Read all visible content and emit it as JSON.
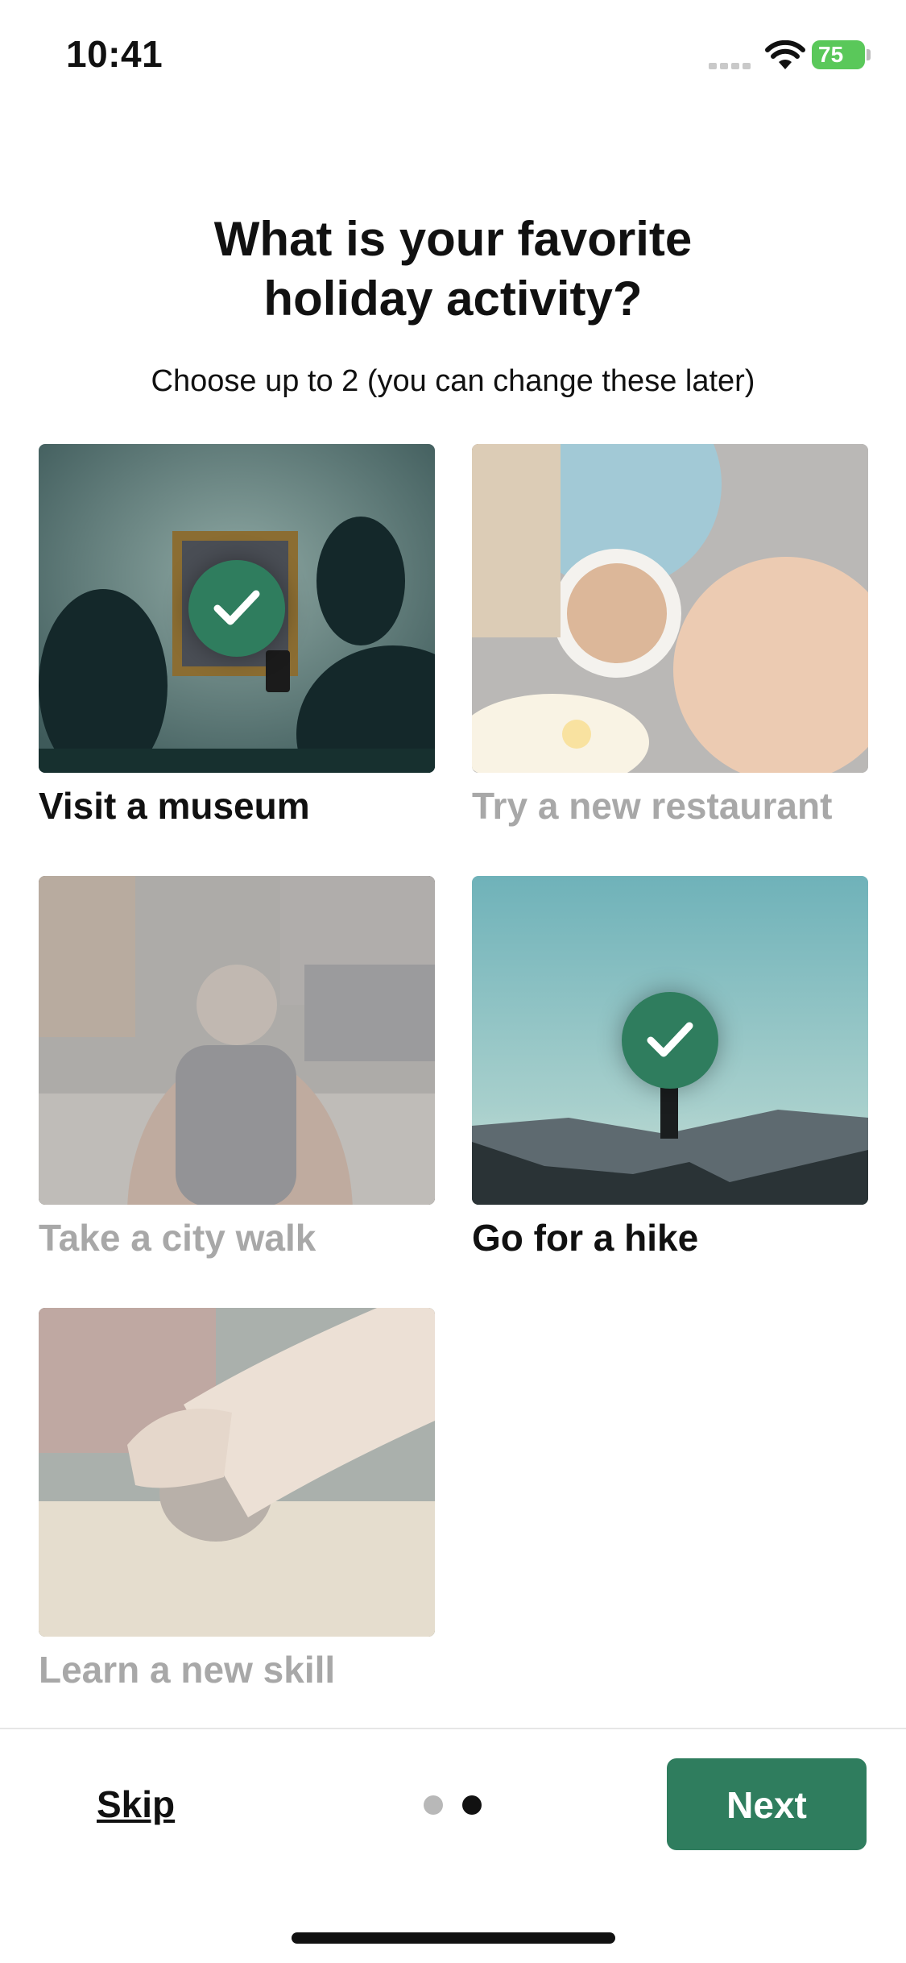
{
  "status_bar": {
    "time": "10:41",
    "battery": "75"
  },
  "header": {
    "title_line1": "What is your favorite",
    "title_line2": "holiday activity?",
    "subtitle": "Choose up to 2 (you can change these later)"
  },
  "activities": [
    {
      "label": "Visit a museum",
      "selected": true
    },
    {
      "label": "Try a new restaurant",
      "selected": false
    },
    {
      "label": "Take a city walk",
      "selected": false
    },
    {
      "label": "Go for a hike",
      "selected": true
    },
    {
      "label": "Learn a new skill",
      "selected": false
    }
  ],
  "footer": {
    "skip_label": "Skip",
    "next_label": "Next",
    "page_current": 2,
    "page_total": 2
  },
  "colors": {
    "accent": "#2f7d5e",
    "unselected_text": "#a8a8a8"
  },
  "icons": {
    "selected_marker": "checkmark-icon"
  }
}
